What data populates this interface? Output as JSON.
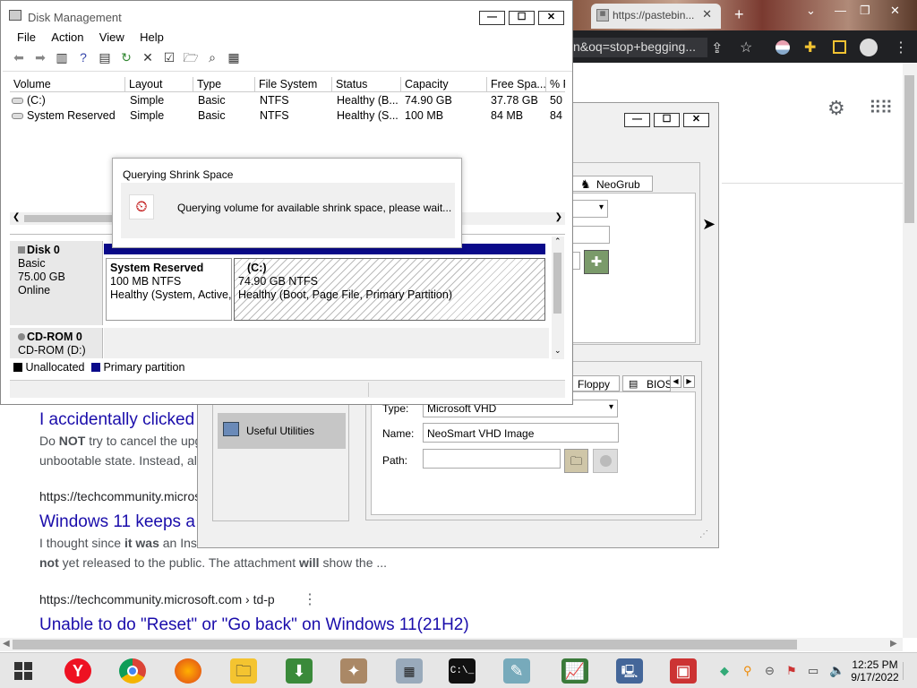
{
  "chrome": {
    "tab_title": "https://pastebin...",
    "address_partial": "n&oq=stop+begging..."
  },
  "search_results": [
    {
      "title": "I accidentally clicked",
      "snippet_line1_pre": "Do ",
      "snippet_line1_bold": "NOT",
      "snippet_line1_post": " try to cancel the upg",
      "snippet_line2": "unbootable state. Instead, al"
    },
    {
      "url": "https://techcommunity.microsof",
      "title": "Windows 11 keeps a",
      "snippet_line1_pre": "I thought since ",
      "snippet_line1_bold": "it was",
      "snippet_line1_post": " an Insi",
      "snippet_line2_bold1": "not",
      "snippet_line2_mid": " yet released to the public. The attachment ",
      "snippet_line2_bold2": "will",
      "snippet_line2_post": " show the ..."
    },
    {
      "url": "https://techcommunity.microsoft.com › td-p",
      "title": "Unable to do \"Reset\" or \"Go back\" on Windows 11(21H2)"
    }
  ],
  "disk_mgmt": {
    "title": "Disk Management",
    "menu": [
      "File",
      "Action",
      "View",
      "Help"
    ],
    "columns": [
      "Volume",
      "Layout",
      "Type",
      "File System",
      "Status",
      "Capacity",
      "Free Spa...",
      "% F"
    ],
    "rows": [
      [
        "(C:)",
        "Simple",
        "Basic",
        "NTFS",
        "Healthy (B...",
        "74.90 GB",
        "37.78 GB",
        "50"
      ],
      [
        "System Reserved",
        "Simple",
        "Basic",
        "NTFS",
        "Healthy (S...",
        "100 MB",
        "84 MB",
        "84"
      ]
    ],
    "disk0": {
      "name": "Disk 0",
      "type": "Basic",
      "size": "75.00 GB",
      "state": "Online"
    },
    "part_sys": {
      "name": "System Reserved",
      "size": "100 MB NTFS",
      "health": "Healthy (System, Active,"
    },
    "part_c": {
      "name": "(C:)",
      "size": "74.90 GB NTFS",
      "health": "Healthy (Boot, Page File, Primary Partition)"
    },
    "cdrom": {
      "name": "CD-ROM 0",
      "sub": "CD-ROM (D:)"
    },
    "legend": [
      "Unallocated",
      "Primary partition"
    ]
  },
  "query_dialog": {
    "title": "Querying Shrink Space",
    "message": "Querying volume for available shrink space, please wait..."
  },
  "easybcd": {
    "tab_neogrub": "NeoGrub",
    "tab_floppy": "Floppy",
    "tab_bios": "BIOS",
    "nav_useful": "Useful Utilities",
    "type_label": "Type:",
    "type_value": "Microsoft VHD",
    "name_label": "Name:",
    "name_value": "NeoSmart VHD Image",
    "path_label": "Path:",
    "path_value": ""
  },
  "taskbar": {
    "time": "12:25 PM",
    "date": "9/17/2022"
  }
}
